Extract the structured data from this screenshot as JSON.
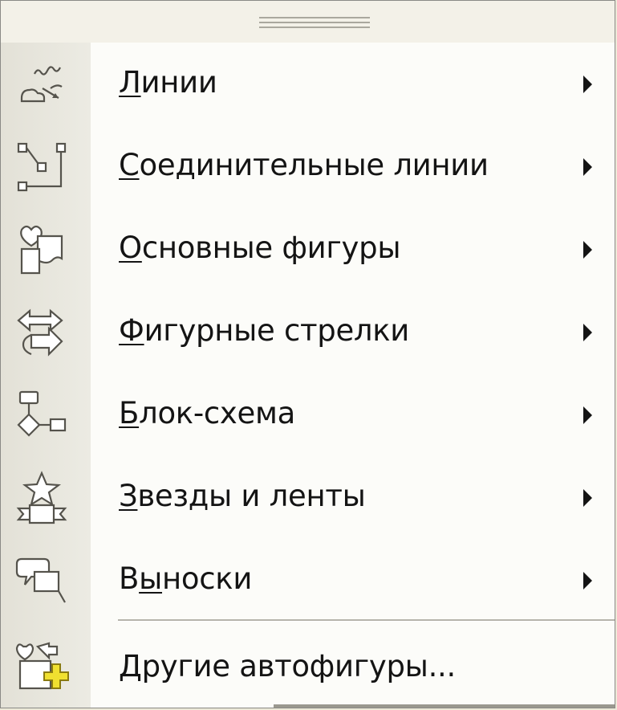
{
  "menu": {
    "items": [
      {
        "name": "lines",
        "accel": "Л",
        "rest": "инии",
        "submenu": true,
        "icon": "lines-icon"
      },
      {
        "name": "connectors",
        "accel": "С",
        "rest": "оединительные линии",
        "submenu": true,
        "icon": "connectors-icon"
      },
      {
        "name": "basic-shapes",
        "accel": "О",
        "rest": "сновные фигуры",
        "submenu": true,
        "icon": "basic-shapes-icon"
      },
      {
        "name": "block-arrows",
        "accel": "Ф",
        "rest": "игурные стрелки",
        "submenu": true,
        "icon": "block-arrows-icon"
      },
      {
        "name": "flowchart",
        "accel": "Б",
        "rest": "лок-схема",
        "submenu": true,
        "icon": "flowchart-icon"
      },
      {
        "name": "stars-banners",
        "accel": "З",
        "rest": "везды и ленты",
        "submenu": true,
        "icon": "stars-banners-icon"
      },
      {
        "name": "callouts",
        "pre": "В",
        "accel": "ы",
        "rest": "носки",
        "submenu": true,
        "icon": "callouts-icon"
      },
      {
        "name": "more-autoshapes",
        "accel": "Д",
        "rest": "ругие автофигуры...",
        "submenu": false,
        "icon": "more-autoshapes-icon"
      }
    ]
  },
  "colors": {
    "menu_background": "#fcfcf9",
    "gutter": "#e3e1d7",
    "text": "#141414",
    "icon_accent": "#f0e030"
  }
}
